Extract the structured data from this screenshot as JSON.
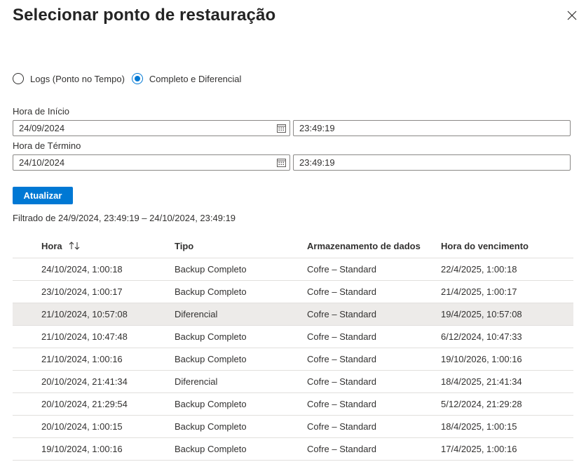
{
  "panel": {
    "title": "Selecionar ponto de restauração"
  },
  "icons": {
    "close": "close-icon",
    "calendar": "calendar-icon",
    "sort": "sort-icon"
  },
  "radio": {
    "options": [
      {
        "label": "Logs (Ponto no Tempo)",
        "checked": false
      },
      {
        "label": "Completo e Diferencial",
        "checked": true
      }
    ]
  },
  "start": {
    "label": "Hora de Início",
    "date": "24/09/2024",
    "time": "23:49:19"
  },
  "end": {
    "label": "Hora de Término",
    "date": "24/10/2024",
    "time": "23:49:19"
  },
  "update_button": "Atualizar",
  "filter_text": "Filtrado de 24/9/2024, 23:49:19 – 24/10/2024, 23:49:19",
  "table": {
    "columns": [
      "Hora",
      "Tipo",
      "Armazenamento de dados",
      "Hora do vencimento"
    ],
    "rows": [
      [
        "24/10/2024, 1:00:18",
        "Backup Completo",
        "Cofre – Standard",
        "22/4/2025, 1:00:18"
      ],
      [
        "23/10/2024, 1:00:17",
        "Backup Completo",
        "Cofre – Standard",
        "21/4/2025, 1:00:17"
      ],
      [
        "21/10/2024, 10:57:08",
        "Diferencial",
        "Cofre – Standard",
        "19/4/2025, 10:57:08"
      ],
      [
        "21/10/2024, 10:47:48",
        "Backup Completo",
        "Cofre – Standard",
        "6/12/2024, 10:47:33"
      ],
      [
        "21/10/2024, 1:00:16",
        "Backup Completo",
        "Cofre – Standard",
        "19/10/2026, 1:00:16"
      ],
      [
        "20/10/2024, 21:41:34",
        "Diferencial",
        "Cofre – Standard",
        "18/4/2025, 21:41:34"
      ],
      [
        "20/10/2024, 21:29:54",
        "Backup Completo",
        "Cofre – Standard",
        "5/12/2024, 21:29:28"
      ],
      [
        "20/10/2024, 1:00:15",
        "Backup Completo",
        "Cofre – Standard",
        "18/4/2025, 1:00:15"
      ],
      [
        "19/10/2024, 1:00:16",
        "Backup Completo",
        "Cofre – Standard",
        "17/4/2025, 1:00:16"
      ]
    ],
    "selected_row": 2
  },
  "colors": {
    "accent": "#0078d4",
    "selected_row": "#edebe9",
    "border": "#8a8886",
    "divider": "#e1dfdd"
  }
}
